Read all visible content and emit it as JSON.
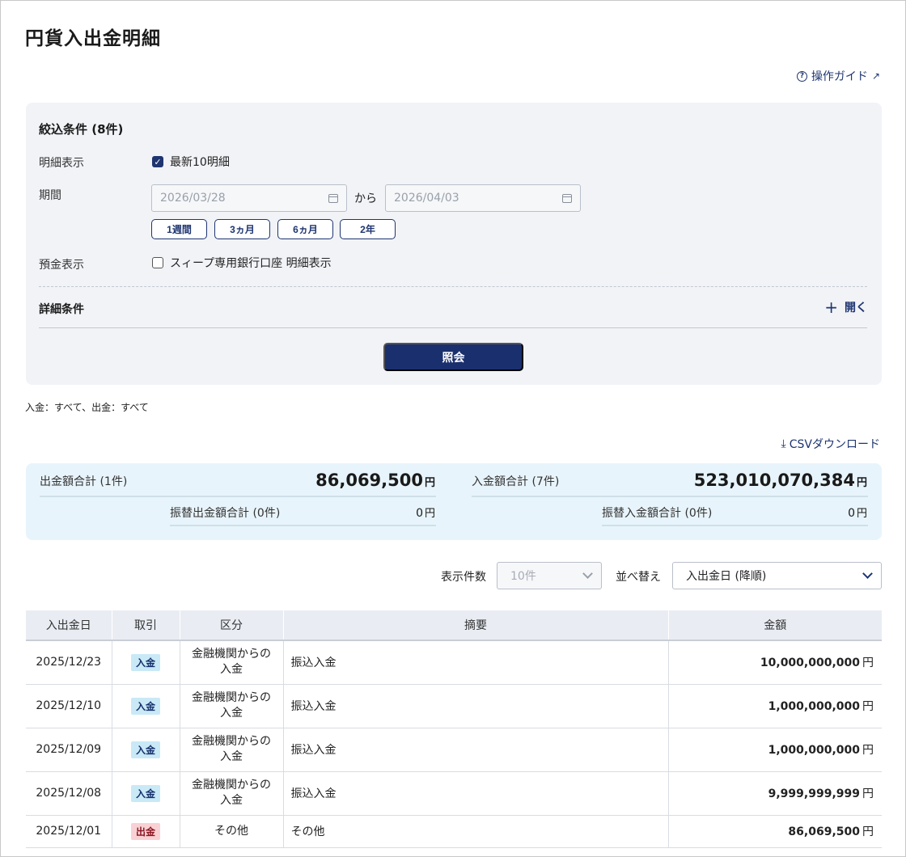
{
  "page": {
    "title": "円貨入出金明細",
    "guide_label": "操作ガイド"
  },
  "filter": {
    "title": "絞込条件 (8件)",
    "display_label": "明細表示",
    "latest_label": "最新10明細",
    "latest_checked": true,
    "period_label": "期間",
    "date_from_placeholder": "2026/03/28",
    "date_to_placeholder": "2026/04/03",
    "kara": "から",
    "period_buttons": [
      "1週間",
      "3ヵ月",
      "6ヵ月",
      "2年"
    ],
    "deposit_label": "預金表示",
    "sweep_label": "スィープ専用銀行口座 明細表示",
    "sweep_checked": false,
    "detail_label": "詳細条件",
    "open_label": "開く",
    "search_label": "照会"
  },
  "summary_line": "入金：すべて、出金：すべて",
  "csv_label": "CSVダウンロード",
  "totals": {
    "unit": "円",
    "withdrawal_label": "出金額合計 (1件)",
    "withdrawal_value": "86,069,500",
    "deposit_label": "入金額合計 (7件)",
    "deposit_value": "523,010,070,384",
    "transfer_out_label": "振替出金額合計 (0件)",
    "transfer_out_value": "0",
    "transfer_in_label": "振替入金額合計 (0件)",
    "transfer_in_value": "0"
  },
  "controls": {
    "count_label": "表示件数",
    "count_value": "10件",
    "sort_label": "並べ替え",
    "sort_value": "入出金日 (降順)"
  },
  "table": {
    "headers": [
      "入出金日",
      "取引",
      "区分",
      "摘要",
      "金額"
    ],
    "unit": "円",
    "rows": [
      {
        "date": "2025/12/23",
        "kind": "入金",
        "cat": "金融機関からの入金",
        "desc": "振込入金",
        "amount": "10,000,000,000"
      },
      {
        "date": "2025/12/10",
        "kind": "入金",
        "cat": "金融機関からの入金",
        "desc": "振込入金",
        "amount": "1,000,000,000"
      },
      {
        "date": "2025/12/09",
        "kind": "入金",
        "cat": "金融機関からの入金",
        "desc": "振込入金",
        "amount": "1,000,000,000"
      },
      {
        "date": "2025/12/08",
        "kind": "入金",
        "cat": "金融機関からの入金",
        "desc": "振込入金",
        "amount": "9,999,999,999"
      },
      {
        "date": "2025/12/01",
        "kind": "出金",
        "cat": "その他",
        "desc": "その他",
        "amount": "86,069,500"
      }
    ]
  },
  "colors": {
    "brand_navy": "#1a2f6e",
    "deposit_badge": "#c9e9f7",
    "withdraw_badge": "#f9d1d4",
    "totals_bg": "#e8f4fb",
    "filter_bg": "#f1f3f7"
  },
  "icons": {
    "guide": "question-circle-icon",
    "external": "external-link-icon",
    "calendar": "calendar-icon",
    "plus": "plus-icon",
    "download": "download-icon",
    "chevron": "chevron-down-icon"
  }
}
